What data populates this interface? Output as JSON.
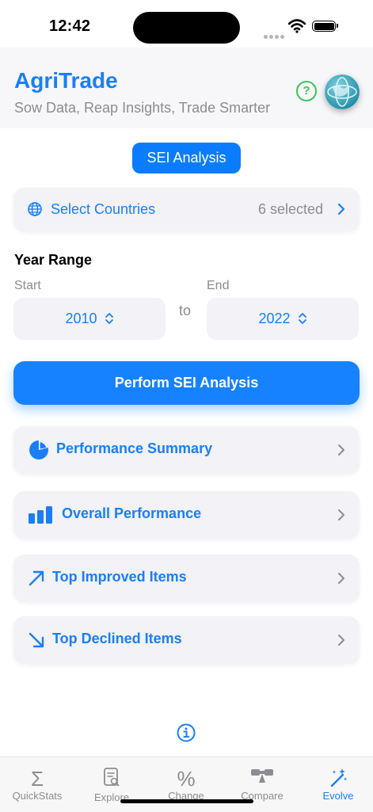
{
  "status_bar": {
    "time": "12:42"
  },
  "header": {
    "title": "AgriTrade",
    "subtitle": "Sow Data, Reap Insights, Trade Smarter",
    "help_icon": "question-circle-icon",
    "avatar_icon": "globe-logo-icon"
  },
  "segment": {
    "label": "SEI Analysis"
  },
  "countries": {
    "label": "Select Countries",
    "value": "6 selected",
    "icon": "globe-icon"
  },
  "year_range": {
    "title": "Year Range",
    "start_label": "Start",
    "end_label": "End",
    "start_value": "2010",
    "end_value": "2022",
    "to_label": "to"
  },
  "perform_button": {
    "label": "Perform SEI Analysis"
  },
  "sections": [
    {
      "label": "Performance Summary",
      "icon": "pie-chart-icon"
    },
    {
      "label": "Overall Performance",
      "icon": "bar-chart-icon"
    },
    {
      "label": "Top Improved Items",
      "icon": "arrow-up-right-icon"
    },
    {
      "label": "Top Declined Items",
      "icon": "arrow-down-right-icon"
    }
  ],
  "tabs": [
    {
      "label": "QuickStats",
      "icon": "sigma-icon"
    },
    {
      "label": "Explore",
      "icon": "document-search-icon"
    },
    {
      "label": "Change",
      "icon": "percent-icon"
    },
    {
      "label": "Compare",
      "icon": "scale-icon"
    },
    {
      "label": "Evolve",
      "icon": "sparkles-icon",
      "active": true
    }
  ],
  "colors": {
    "accent": "#1a7ff5",
    "button": "#0a7cff",
    "help": "#34c759",
    "card": "#f2f2f7",
    "muted": "#8c8c91"
  }
}
